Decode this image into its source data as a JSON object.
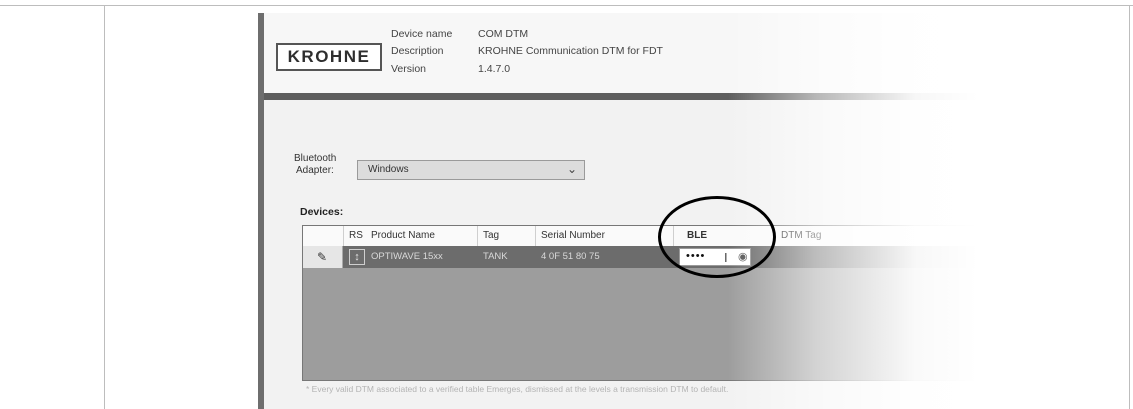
{
  "header": {
    "logo_text": "KROHNE",
    "device_name_label": "Device name",
    "device_name_value": "COM DTM",
    "description_label": "Description",
    "description_value": "KROHNE Communication DTM for FDT",
    "version_label": "Version",
    "version_value": "1.4.7.0"
  },
  "bluetooth": {
    "group_label": "Bluetooth",
    "adapter_label": "Adapter:",
    "adapter_value": "Windows"
  },
  "devices": {
    "label": "Devices:",
    "columns": [
      "RS",
      "Product Name",
      "Tag",
      "Serial Number",
      "BLE",
      "DTM Tag"
    ],
    "rows": [
      {
        "product_name": "OPTIWAVE 15xx",
        "tag": "TANK",
        "serial_number": "4 0F 51 80 75",
        "ble_password": "••••"
      }
    ]
  },
  "footnote": "* Every valid DTM associated to a verified table Emerges, dismissed at the levels a transmission DTM to default.",
  "colors": {
    "selected_row": "#6c6c6c",
    "highlight_circle": "#000000"
  },
  "icons": [
    "pencil-icon",
    "rs-status-icon",
    "text-cursor-icon",
    "eye-icon",
    "chevron-down-icon"
  ]
}
